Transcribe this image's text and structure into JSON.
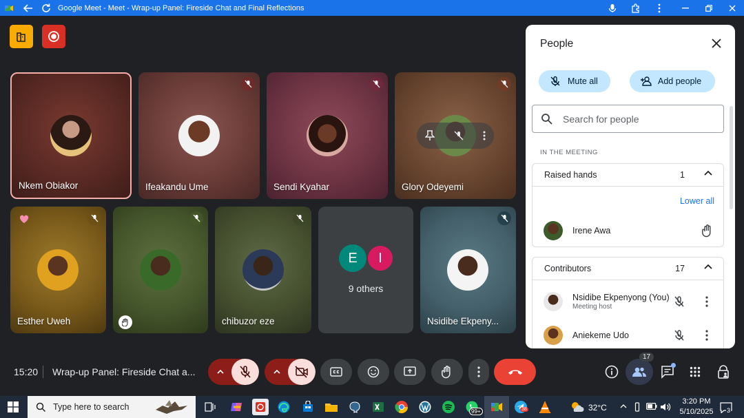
{
  "window": {
    "title": "Google Meet - Meet - Wrap-up Panel: Fireside Chat and Final Reflections"
  },
  "tiles": [
    {
      "name": "Nkem Obiakor"
    },
    {
      "name": "Ifeakandu Ume"
    },
    {
      "name": "Sendi Kyahar"
    },
    {
      "name": "Glory Odeyemi"
    },
    {
      "name": "Esther Uweh"
    },
    {
      "name": ""
    },
    {
      "name": "chibuzor eze"
    },
    {
      "name": "9 others",
      "initial_1": "E",
      "initial_2": "I"
    },
    {
      "name": "Nsidibe Ekpeny..."
    }
  ],
  "panel": {
    "title": "People",
    "mute_all": "Mute all",
    "add_people": "Add people",
    "search_placeholder": "Search for people",
    "section": "IN THE MEETING",
    "raised": {
      "label": "Raised hands",
      "count": "1",
      "lower_all": "Lower all",
      "person": "Irene Awa"
    },
    "contributors": {
      "label": "Contributors",
      "count": "17",
      "people": [
        {
          "name": "Nsidibe Ekpenyong (You)",
          "sub": "Meeting host"
        },
        {
          "name": "Aniekeme Udo",
          "sub": ""
        }
      ]
    }
  },
  "bottombar": {
    "time": "15:20",
    "meeting_title": "Wrap-up Panel: Fireside Chat a...",
    "people_count": "17"
  },
  "taskbar": {
    "search_placeholder": "Type here to search",
    "badge_99": "99+",
    "badge_38": "38",
    "temperature": "32°C",
    "clock_time": "3:20 PM",
    "clock_date": "5/10/2025",
    "notif_count": "3"
  },
  "colors": {
    "accent": "#1a73e8",
    "end_call": "#ea4335",
    "panel_pill": "#c2e7ff",
    "muted_control": "#f9dedc"
  }
}
